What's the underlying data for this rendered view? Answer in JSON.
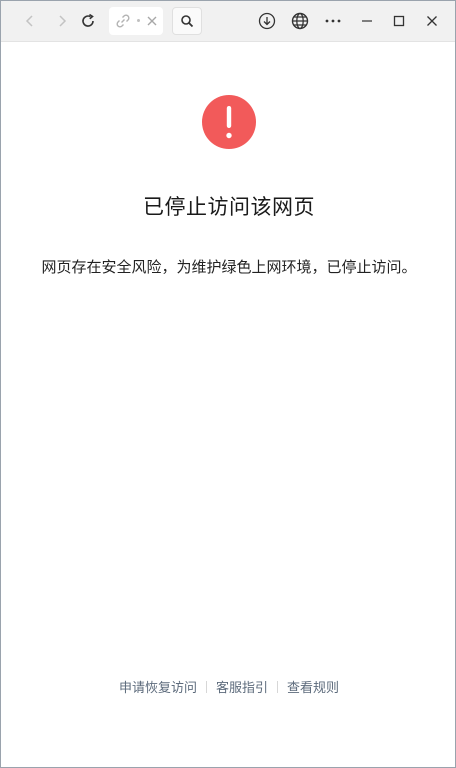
{
  "toolbar": {
    "back_icon": "chevron-left-icon",
    "forward_icon": "chevron-right-icon",
    "reload_icon": "reload-icon",
    "link_icon": "link-icon",
    "clear_icon": "close-icon",
    "search_icon": "search-icon",
    "download_icon": "download-icon",
    "globe_icon": "globe-icon",
    "more_icon": "more-icon",
    "minimize_icon": "minimize-icon",
    "maximize_icon": "maximize-icon",
    "close_icon": "close-icon"
  },
  "page": {
    "alert_icon": "exclamation-icon",
    "alert_color": "#f25a5a",
    "title": "已停止访问该网页",
    "message": "网页存在安全风险，为维护绿色上网环境，已停止访问。"
  },
  "footer": {
    "links": [
      "申请恢复访问",
      "客服指引",
      "查看规则"
    ]
  }
}
